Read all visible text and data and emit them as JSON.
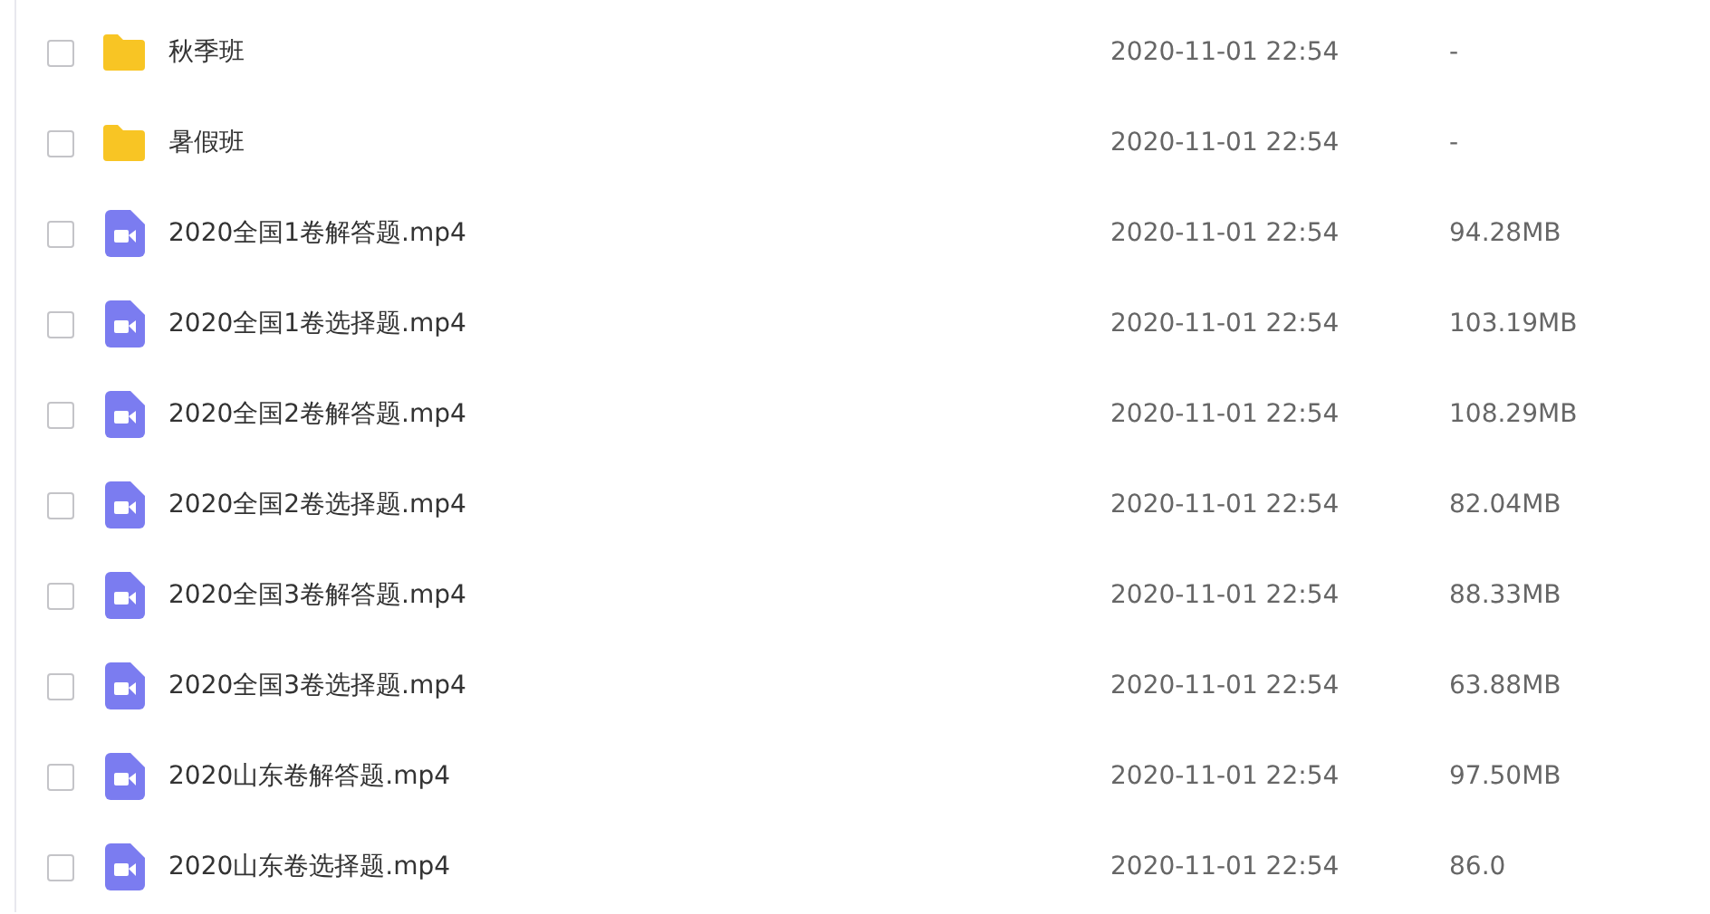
{
  "files": [
    {
      "kind": "folder",
      "name": "秋季班",
      "modified": "2020-11-01 22:54",
      "size": "-",
      "checked": false
    },
    {
      "kind": "folder",
      "name": "暑假班",
      "modified": "2020-11-01 22:54",
      "size": "-",
      "checked": false
    },
    {
      "kind": "video",
      "name": "2020全国1卷解答题.mp4",
      "modified": "2020-11-01 22:54",
      "size": "94.28MB",
      "checked": false
    },
    {
      "kind": "video",
      "name": "2020全国1卷选择题.mp4",
      "modified": "2020-11-01 22:54",
      "size": "103.19MB",
      "checked": false
    },
    {
      "kind": "video",
      "name": "2020全国2卷解答题.mp4",
      "modified": "2020-11-01 22:54",
      "size": "108.29MB",
      "checked": false
    },
    {
      "kind": "video",
      "name": "2020全国2卷选择题.mp4",
      "modified": "2020-11-01 22:54",
      "size": "82.04MB",
      "checked": false
    },
    {
      "kind": "video",
      "name": "2020全国3卷解答题.mp4",
      "modified": "2020-11-01 22:54",
      "size": "88.33MB",
      "checked": false
    },
    {
      "kind": "video",
      "name": "2020全国3卷选择题.mp4",
      "modified": "2020-11-01 22:54",
      "size": "63.88MB",
      "checked": false
    },
    {
      "kind": "video",
      "name": "2020山东卷解答题.mp4",
      "modified": "2020-11-01 22:54",
      "size": "97.50MB",
      "checked": false
    },
    {
      "kind": "video",
      "name": "2020山东卷选择题.mp4",
      "modified": "2020-11-01 22:54",
      "size": "86.0",
      "checked": false
    }
  ]
}
